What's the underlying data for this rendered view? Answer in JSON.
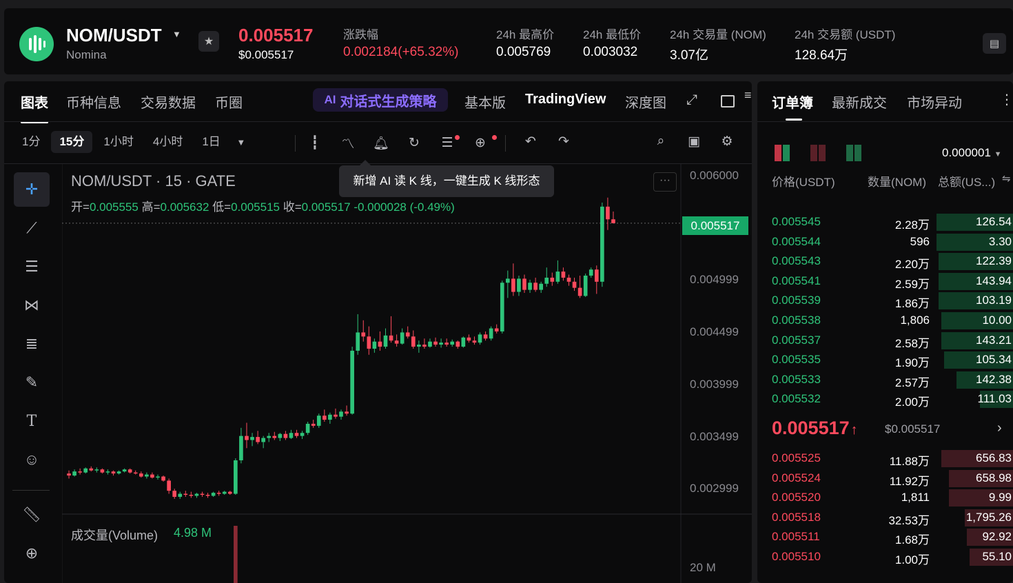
{
  "header": {
    "pair": "NOM/USDT",
    "name": "Nomina",
    "price": "0.005517",
    "price_usd": "$0.005517",
    "stats": [
      {
        "label": "涨跌幅",
        "value": "0.002184(+65.32%)"
      },
      {
        "label": "24h 最高价",
        "value": "0.005769"
      },
      {
        "label": "24h 最低价",
        "value": "0.003032"
      },
      {
        "label": "24h 交易量 (NOM)",
        "value": "3.07亿"
      },
      {
        "label": "24h 交易额 (USDT)",
        "value": "128.64万"
      }
    ]
  },
  "chart_tabs": {
    "items": [
      "图表",
      "币种信息",
      "交易数据",
      "币圈"
    ],
    "ai_label": "对话式生成策略",
    "ai_icon": "AI",
    "views": [
      "基本版",
      "TradingView",
      "深度图"
    ]
  },
  "toolbar": {
    "timeframes": [
      "1分",
      "15分",
      "1小时",
      "4小时",
      "1日"
    ],
    "active_timeframe": "15分"
  },
  "tooltip": "新增 AI 读 K 线，一键生成 K 线形态",
  "chart": {
    "symbol_line": "NOM/USDT · 15 · GATE",
    "ohlc": {
      "open_label": "开=",
      "open": "0.005555",
      "high_label": "高=",
      "high": "0.005632",
      "low_label": "低=",
      "low": "0.005515",
      "close_label": "收=",
      "close": "0.005517",
      "change": "-0.000028 (-0.49%)"
    },
    "more": "···",
    "current_price_tag": "0.005517",
    "volume_label": "成交量(Volume)",
    "volume_value": "4.98 M",
    "volume_axis": "20 M"
  },
  "chart_data": {
    "type": "candlestick",
    "y_ticks": [
      "0.006000",
      "0.004999",
      "0.004499",
      "0.003999",
      "0.003499",
      "0.002999"
    ],
    "y_range": [
      0.00265,
      0.0061
    ],
    "last_price": 0.005517,
    "colors": {
      "up": "#2ec47a",
      "down": "#ff4a5d"
    },
    "candles": [
      [
        0.00305,
        0.00308,
        0.003,
        0.00303
      ],
      [
        0.00303,
        0.00309,
        0.00302,
        0.00307
      ],
      [
        0.00307,
        0.0031,
        0.00304,
        0.00306
      ],
      [
        0.00306,
        0.00311,
        0.00305,
        0.0031
      ],
      [
        0.0031,
        0.00312,
        0.00307,
        0.00308
      ],
      [
        0.00308,
        0.00311,
        0.00306,
        0.00309
      ],
      [
        0.00309,
        0.0031,
        0.00305,
        0.00306
      ],
      [
        0.00306,
        0.00309,
        0.00304,
        0.00307
      ],
      [
        0.00307,
        0.00308,
        0.00303,
        0.00305
      ],
      [
        0.00305,
        0.00308,
        0.00304,
        0.00307
      ],
      [
        0.00307,
        0.0031,
        0.00306,
        0.00309
      ],
      [
        0.00309,
        0.0031,
        0.00305,
        0.00306
      ],
      [
        0.00306,
        0.00308,
        0.00304,
        0.00305
      ],
      [
        0.00305,
        0.00307,
        0.00301,
        0.00302
      ],
      [
        0.00302,
        0.00306,
        0.003,
        0.00304
      ],
      [
        0.00304,
        0.00306,
        0.003,
        0.00301
      ],
      [
        0.00301,
        0.00304,
        0.00299,
        0.00302
      ],
      [
        0.00302,
        0.00303,
        0.00297,
        0.00298
      ],
      [
        0.00298,
        0.003,
        0.00285,
        0.00288
      ],
      [
        0.00288,
        0.0029,
        0.0028,
        0.00282
      ],
      [
        0.00282,
        0.00287,
        0.0028,
        0.00285
      ],
      [
        0.00285,
        0.00288,
        0.00282,
        0.00284
      ],
      [
        0.00284,
        0.00287,
        0.00281,
        0.00283
      ],
      [
        0.00283,
        0.00286,
        0.00281,
        0.00285
      ],
      [
        0.00285,
        0.00287,
        0.00282,
        0.00284
      ],
      [
        0.00284,
        0.00286,
        0.00281,
        0.00283
      ],
      [
        0.00283,
        0.00287,
        0.00282,
        0.00286
      ],
      [
        0.00286,
        0.00288,
        0.00283,
        0.00285
      ],
      [
        0.00285,
        0.00288,
        0.00284,
        0.00287
      ],
      [
        0.00287,
        0.00288,
        0.00284,
        0.00285
      ],
      [
        0.00285,
        0.0032,
        0.00284,
        0.00318
      ],
      [
        0.00318,
        0.0035,
        0.00315,
        0.00342
      ],
      [
        0.00342,
        0.00355,
        0.0033,
        0.00338
      ],
      [
        0.00338,
        0.00345,
        0.00332,
        0.00341
      ],
      [
        0.00341,
        0.00347,
        0.00334,
        0.00336
      ],
      [
        0.00336,
        0.00342,
        0.0033,
        0.0034
      ],
      [
        0.0034,
        0.00345,
        0.00336,
        0.00342
      ],
      [
        0.00342,
        0.00346,
        0.00338,
        0.0034
      ],
      [
        0.0034,
        0.00345,
        0.00337,
        0.00344
      ],
      [
        0.00344,
        0.00347,
        0.00338,
        0.0034
      ],
      [
        0.0034,
        0.00348,
        0.00339,
        0.00345
      ],
      [
        0.00345,
        0.00348,
        0.0034,
        0.00342
      ],
      [
        0.00342,
        0.00347,
        0.00339,
        0.00345
      ],
      [
        0.00345,
        0.00356,
        0.00343,
        0.00354
      ],
      [
        0.00354,
        0.00358,
        0.0035,
        0.00352
      ],
      [
        0.00352,
        0.00364,
        0.0035,
        0.00362
      ],
      [
        0.00362,
        0.00368,
        0.00356,
        0.00358
      ],
      [
        0.00358,
        0.00365,
        0.00354,
        0.00363
      ],
      [
        0.00363,
        0.00369,
        0.00359,
        0.00361
      ],
      [
        0.00361,
        0.00368,
        0.00358,
        0.00366
      ],
      [
        0.00366,
        0.00372,
        0.00362,
        0.00364
      ],
      [
        0.00364,
        0.0043,
        0.00363,
        0.00426
      ],
      [
        0.00426,
        0.00462,
        0.00422,
        0.00444
      ],
      [
        0.00444,
        0.00456,
        0.00435,
        0.0044
      ],
      [
        0.0044,
        0.0045,
        0.00422,
        0.00428
      ],
      [
        0.00428,
        0.00438,
        0.00424,
        0.00435
      ],
      [
        0.00435,
        0.00445,
        0.00426,
        0.0043
      ],
      [
        0.0043,
        0.00448,
        0.00428,
        0.00441
      ],
      [
        0.00441,
        0.0046,
        0.00434,
        0.00436
      ],
      [
        0.00436,
        0.00442,
        0.0043,
        0.00433
      ],
      [
        0.00433,
        0.00448,
        0.00432,
        0.00444
      ],
      [
        0.00444,
        0.0045,
        0.00438,
        0.0044
      ],
      [
        0.0044,
        0.00446,
        0.00428,
        0.0043
      ],
      [
        0.0043,
        0.00436,
        0.00424,
        0.00432
      ],
      [
        0.00432,
        0.00438,
        0.00428,
        0.0043
      ],
      [
        0.0043,
        0.00438,
        0.00429,
        0.00435
      ],
      [
        0.00435,
        0.00439,
        0.0043,
        0.00432
      ],
      [
        0.00432,
        0.00438,
        0.00429,
        0.00434
      ],
      [
        0.00434,
        0.00438,
        0.0043,
        0.00432
      ],
      [
        0.00432,
        0.00437,
        0.0043,
        0.00435
      ],
      [
        0.00435,
        0.00436,
        0.00428,
        0.0043
      ],
      [
        0.0043,
        0.0044,
        0.00429,
        0.00439
      ],
      [
        0.00439,
        0.00442,
        0.00434,
        0.00436
      ],
      [
        0.00436,
        0.0044,
        0.00432,
        0.00434
      ],
      [
        0.00434,
        0.00444,
        0.00432,
        0.00442
      ],
      [
        0.00442,
        0.00445,
        0.00436,
        0.00438
      ],
      [
        0.00438,
        0.0045,
        0.00436,
        0.00448
      ],
      [
        0.00448,
        0.00452,
        0.00443,
        0.00445
      ],
      [
        0.00445,
        0.00495,
        0.00443,
        0.00493
      ],
      [
        0.00493,
        0.00505,
        0.00478,
        0.00497
      ],
      [
        0.00497,
        0.00512,
        0.0048,
        0.00484
      ],
      [
        0.00484,
        0.005,
        0.0048,
        0.00497
      ],
      [
        0.00497,
        0.00501,
        0.00483,
        0.00486
      ],
      [
        0.00486,
        0.00496,
        0.00483,
        0.00493
      ],
      [
        0.00493,
        0.00498,
        0.00484,
        0.00486
      ],
      [
        0.00486,
        0.00494,
        0.00483,
        0.00492
      ],
      [
        0.00492,
        0.00508,
        0.00489,
        0.00498
      ],
      [
        0.00498,
        0.00503,
        0.0049,
        0.00494
      ],
      [
        0.00494,
        0.00515,
        0.00492,
        0.00504
      ],
      [
        0.00504,
        0.00508,
        0.00495,
        0.00498
      ],
      [
        0.00498,
        0.00501,
        0.0049,
        0.00494
      ],
      [
        0.00494,
        0.00498,
        0.00485,
        0.00488
      ],
      [
        0.00488,
        0.005,
        0.00478,
        0.0048
      ],
      [
        0.0048,
        0.00502,
        0.00479,
        0.005
      ],
      [
        0.005,
        0.00508,
        0.00498,
        0.00506
      ],
      [
        0.00506,
        0.0051,
        0.00482,
        0.00494
      ],
      [
        0.00494,
        0.00572,
        0.00489,
        0.00568
      ],
      [
        0.00568,
        0.005769,
        0.00545,
        0.005555
      ],
      [
        0.005555,
        0.005632,
        0.005515,
        0.005517
      ]
    ],
    "volume_bar_value": 4.98
  },
  "orderbook": {
    "tabs": [
      "订单簿",
      "最新成交",
      "市场异动"
    ],
    "precision": "0.000001",
    "headers": {
      "price": "价格(USDT)",
      "qty": "数量(NOM)",
      "total": "总额(US...)"
    },
    "asks": [
      {
        "price": "0.005545",
        "qty": "2.28万",
        "total": "126.54",
        "depth": 0.3
      },
      {
        "price": "0.005544",
        "qty": "596",
        "total": "3.30",
        "depth": 0.3
      },
      {
        "price": "0.005543",
        "qty": "2.20万",
        "total": "122.39",
        "depth": 0.29
      },
      {
        "price": "0.005541",
        "qty": "2.59万",
        "total": "143.94",
        "depth": 0.29
      },
      {
        "price": "0.005539",
        "qty": "1.86万",
        "total": "103.19",
        "depth": 0.29
      },
      {
        "price": "0.005538",
        "qty": "1,806",
        "total": "10.00",
        "depth": 0.28
      },
      {
        "price": "0.005537",
        "qty": "2.58万",
        "total": "143.21",
        "depth": 0.28
      },
      {
        "price": "0.005535",
        "qty": "1.90万",
        "total": "105.34",
        "depth": 0.27
      },
      {
        "price": "0.005533",
        "qty": "2.57万",
        "total": "142.38",
        "depth": 0.22
      },
      {
        "price": "0.005532",
        "qty": "2.00万",
        "total": "111.03",
        "depth": 0.13
      }
    ],
    "last_price": "0.005517",
    "last_arrow": "↑",
    "last_usd": "$0.005517",
    "bids": [
      {
        "price": "0.005525",
        "qty": "11.88万",
        "total": "656.83",
        "depth": 0.28
      },
      {
        "price": "0.005524",
        "qty": "11.92万",
        "total": "658.98",
        "depth": 0.25
      },
      {
        "price": "0.005520",
        "qty": "1,811",
        "total": "9.99",
        "depth": 0.25
      },
      {
        "price": "0.005518",
        "qty": "32.53万",
        "total": "1,795.26",
        "depth": 0.19
      },
      {
        "price": "0.005511",
        "qty": "1.68万",
        "total": "92.92",
        "depth": 0.18
      },
      {
        "price": "0.005510",
        "qty": "1.00万",
        "total": "55.10",
        "depth": 0.17
      }
    ]
  }
}
